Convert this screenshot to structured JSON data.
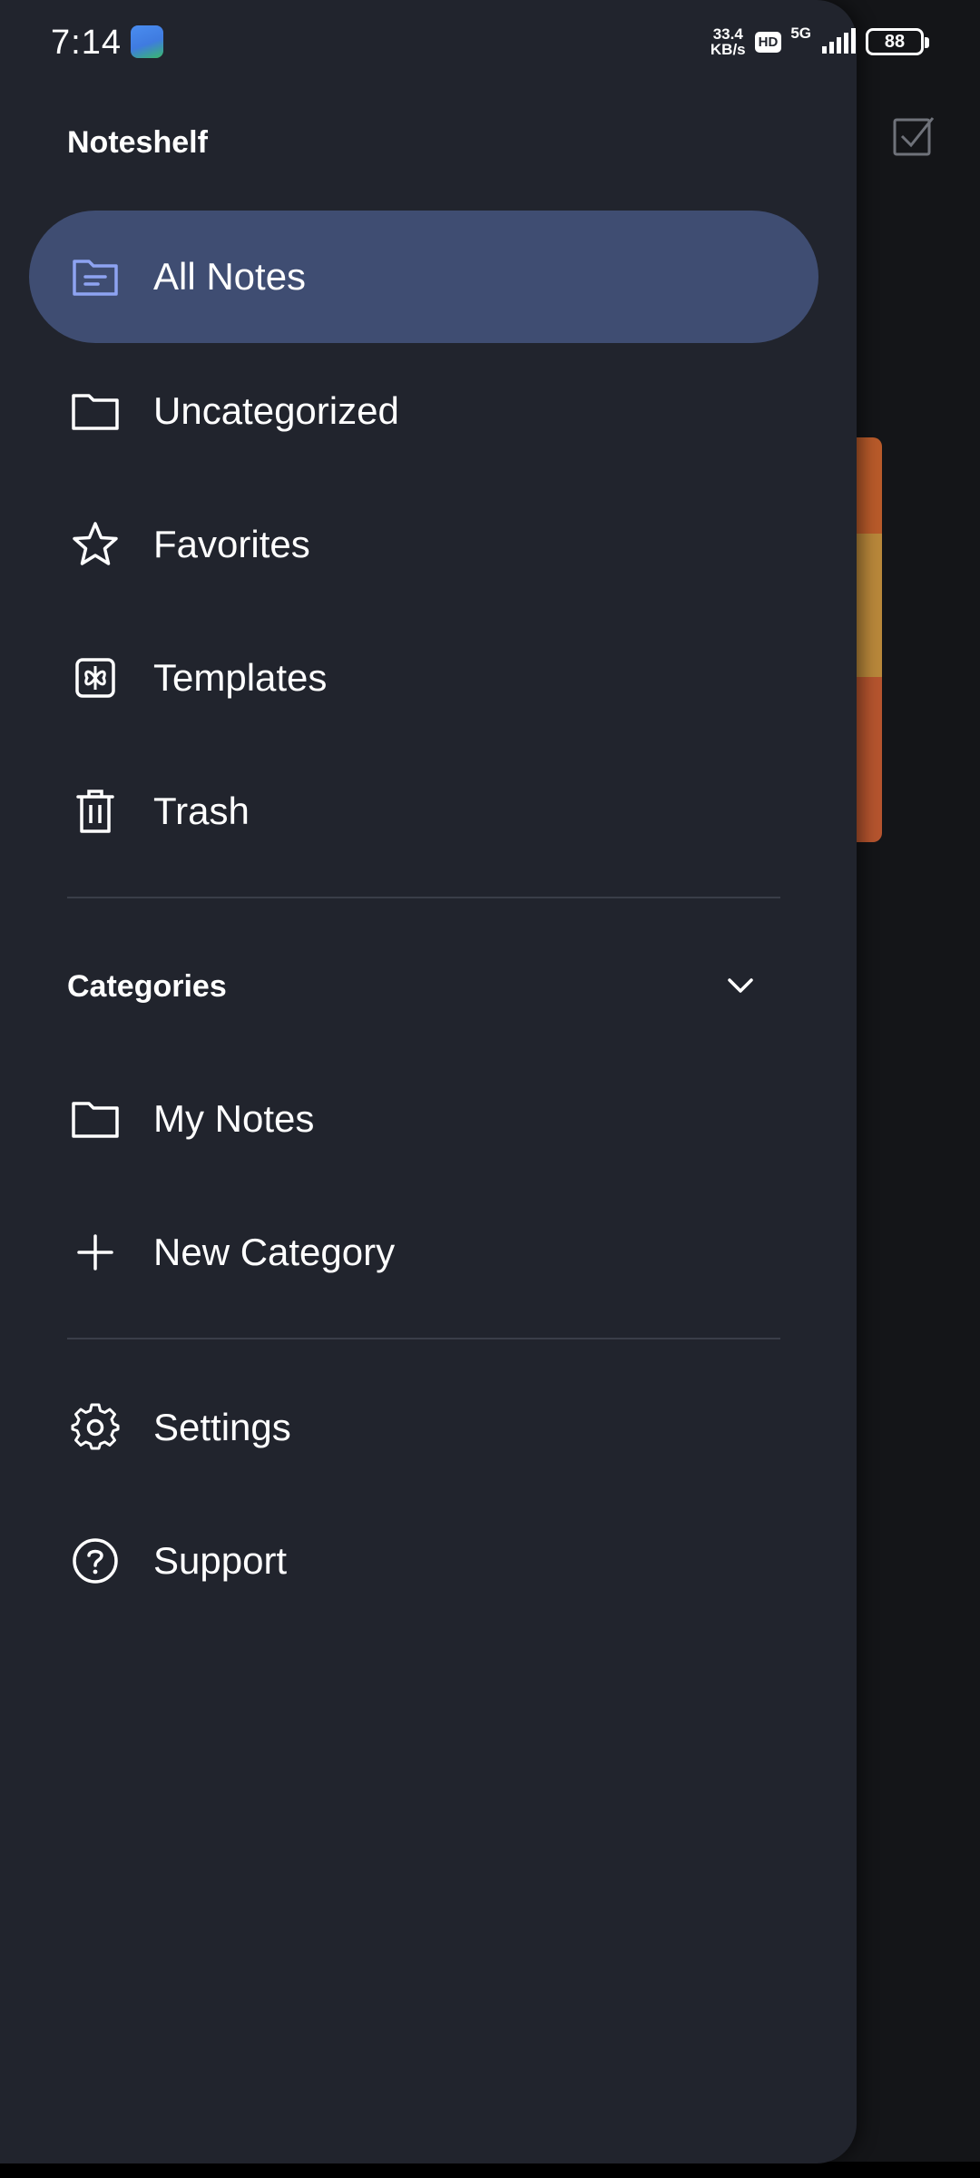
{
  "status_bar": {
    "time": "7:14",
    "net_speed_value": "33.4",
    "net_speed_unit": "KB/s",
    "hd": "HD",
    "network": "5G",
    "battery": "88"
  },
  "drawer": {
    "title": "Noteshelf",
    "main_items": [
      {
        "label": "All Notes",
        "icon": "folder-open-icon",
        "active": true
      },
      {
        "label": "Uncategorized",
        "icon": "folder-icon"
      },
      {
        "label": "Favorites",
        "icon": "star-icon"
      },
      {
        "label": "Templates",
        "icon": "templates-icon"
      },
      {
        "label": "Trash",
        "icon": "trash-icon"
      }
    ],
    "categories": {
      "label": "Categories",
      "items": [
        {
          "label": "My Notes",
          "icon": "folder-icon"
        },
        {
          "label": "New Category",
          "icon": "plus-icon"
        }
      ]
    },
    "bottom_items": [
      {
        "label": "Settings",
        "icon": "gear-icon"
      },
      {
        "label": "Support",
        "icon": "help-circle-icon"
      }
    ]
  },
  "colors": {
    "drawer_bg": "#21242d",
    "active_bg": "#3f4d72",
    "active_icon": "#8ea3f2",
    "text": "#ffffff"
  }
}
